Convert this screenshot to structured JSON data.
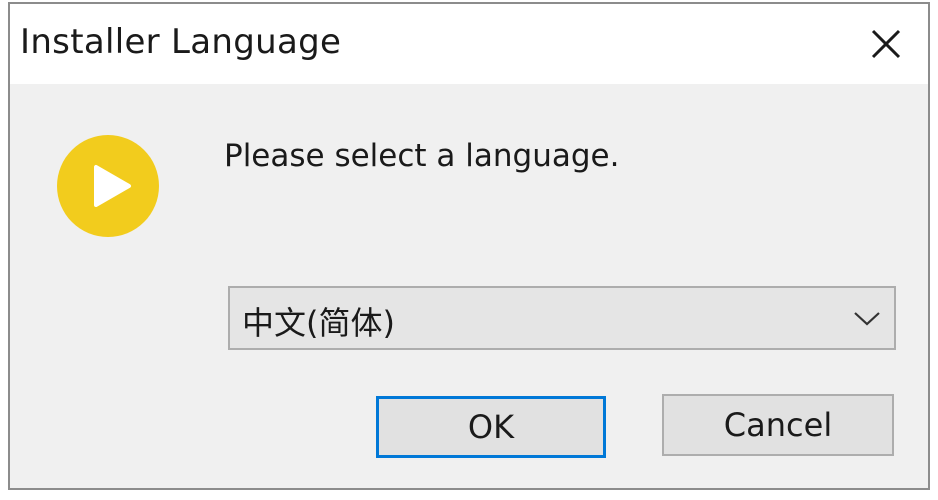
{
  "window": {
    "title": "Installer Language"
  },
  "icons": {
    "app_icon": "play-circle-icon",
    "app_icon_color": "#f2cc1d",
    "close_icon": "close-icon",
    "dropdown_icon": "chevron-down-icon"
  },
  "dialog": {
    "prompt": "Please select a language.",
    "language_select": {
      "selected": "中文(简体)"
    },
    "buttons": {
      "ok_label": "OK",
      "cancel_label": "Cancel"
    }
  },
  "colors": {
    "focus_border": "#0078d7",
    "dialog_background": "#f0f0f0",
    "titlebar_background": "#ffffff"
  }
}
